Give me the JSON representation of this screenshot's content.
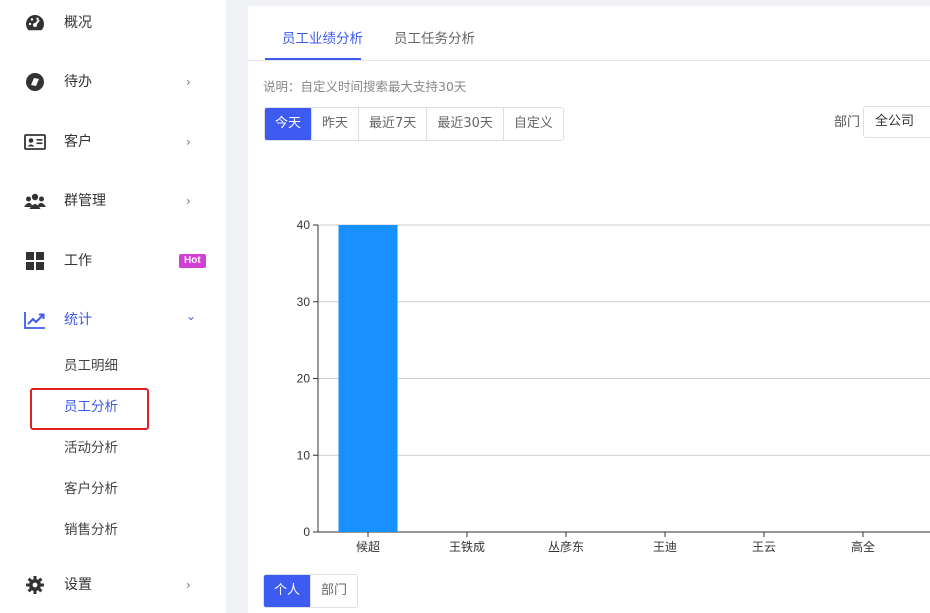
{
  "sidebar": {
    "items": [
      {
        "label": "概况",
        "icon": "dashboard-icon",
        "chevron": ""
      },
      {
        "label": "待办",
        "icon": "todo-icon",
        "chevron": "›"
      },
      {
        "label": "客户",
        "icon": "contact-card-icon",
        "chevron": "›"
      },
      {
        "label": "群管理",
        "icon": "group-icon",
        "chevron": "›"
      },
      {
        "label": "工作",
        "icon": "grid-icon",
        "chevron": ""
      },
      {
        "label": "统计",
        "icon": "trend-chart-icon",
        "chevron": "⌄"
      },
      {
        "label": "设置",
        "icon": "gear-icon",
        "chevron": "›"
      }
    ],
    "hot_badge": "Hot",
    "sub_items": [
      "员工明细",
      "员工分析",
      "活动分析",
      "客户分析",
      "销售分析"
    ],
    "active_color": "#3d5af1"
  },
  "tabs": [
    "员工业绩分析",
    "员工任务分析"
  ],
  "note": "说明：自定义时间搜索最大支持30天",
  "date_filters": [
    "今天",
    "昨天",
    "最近7天",
    "最近30天",
    "自定义"
  ],
  "department": {
    "label": "部门",
    "value": "全公司"
  },
  "view_toggle": [
    "个人",
    "部门"
  ],
  "chart_data": {
    "type": "bar",
    "categories": [
      "候超",
      "王铁成",
      "丛彦东",
      "王迪",
      "王云",
      "高全"
    ],
    "values": [
      40,
      0,
      0,
      0,
      0,
      0
    ],
    "ylim": [
      0,
      40
    ],
    "yticks": [
      0,
      10,
      20,
      30,
      40
    ],
    "grid": true,
    "bar_color": "#1890ff",
    "title": "",
    "xlabel": "",
    "ylabel": ""
  }
}
